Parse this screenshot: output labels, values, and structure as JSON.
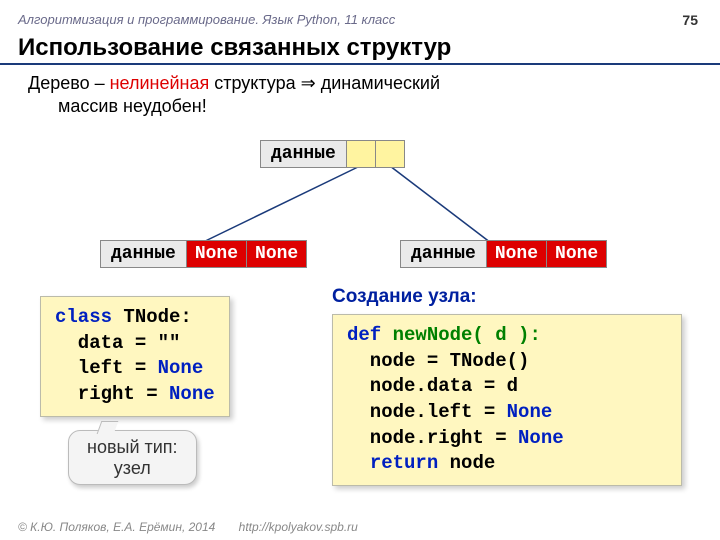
{
  "header": {
    "course_line": "Алгоритмизация и программирование. Язык Python, 11 класс",
    "page_number": "75"
  },
  "title": "Использование связанных структур",
  "subtitle": {
    "lead": "Дерево – ",
    "em": "нелинейная",
    "rest1": " структура ⇒ динамический",
    "rest2": "массив неудобен!"
  },
  "tree": {
    "data_label": "данные",
    "none_label": "None"
  },
  "class_code": {
    "kw_class": "class",
    "name": " TNode:",
    "l2": "  data = \"\"",
    "l3a": "  left = ",
    "l3b": "None",
    "l4a": "  right = ",
    "l4b": "None"
  },
  "create_label": "Создание узла:",
  "func_code": {
    "kw_def": "def",
    "name": " newNode( d ):",
    "l2": "  node = TNode()",
    "l3": "  node.data = d",
    "l4a": "  node.left = ",
    "l4b": "None",
    "l5a": "  node.right = ",
    "l5b": "None",
    "l6a": "  ",
    "l6b": "return",
    "l6c": " node"
  },
  "callout": {
    "line1": "новый тип:",
    "line2": "узел"
  },
  "footer": {
    "copyright": "© К.Ю. Поляков, Е.А. Ерёмин, 2014",
    "url": "http://kpolyakov.spb.ru"
  }
}
